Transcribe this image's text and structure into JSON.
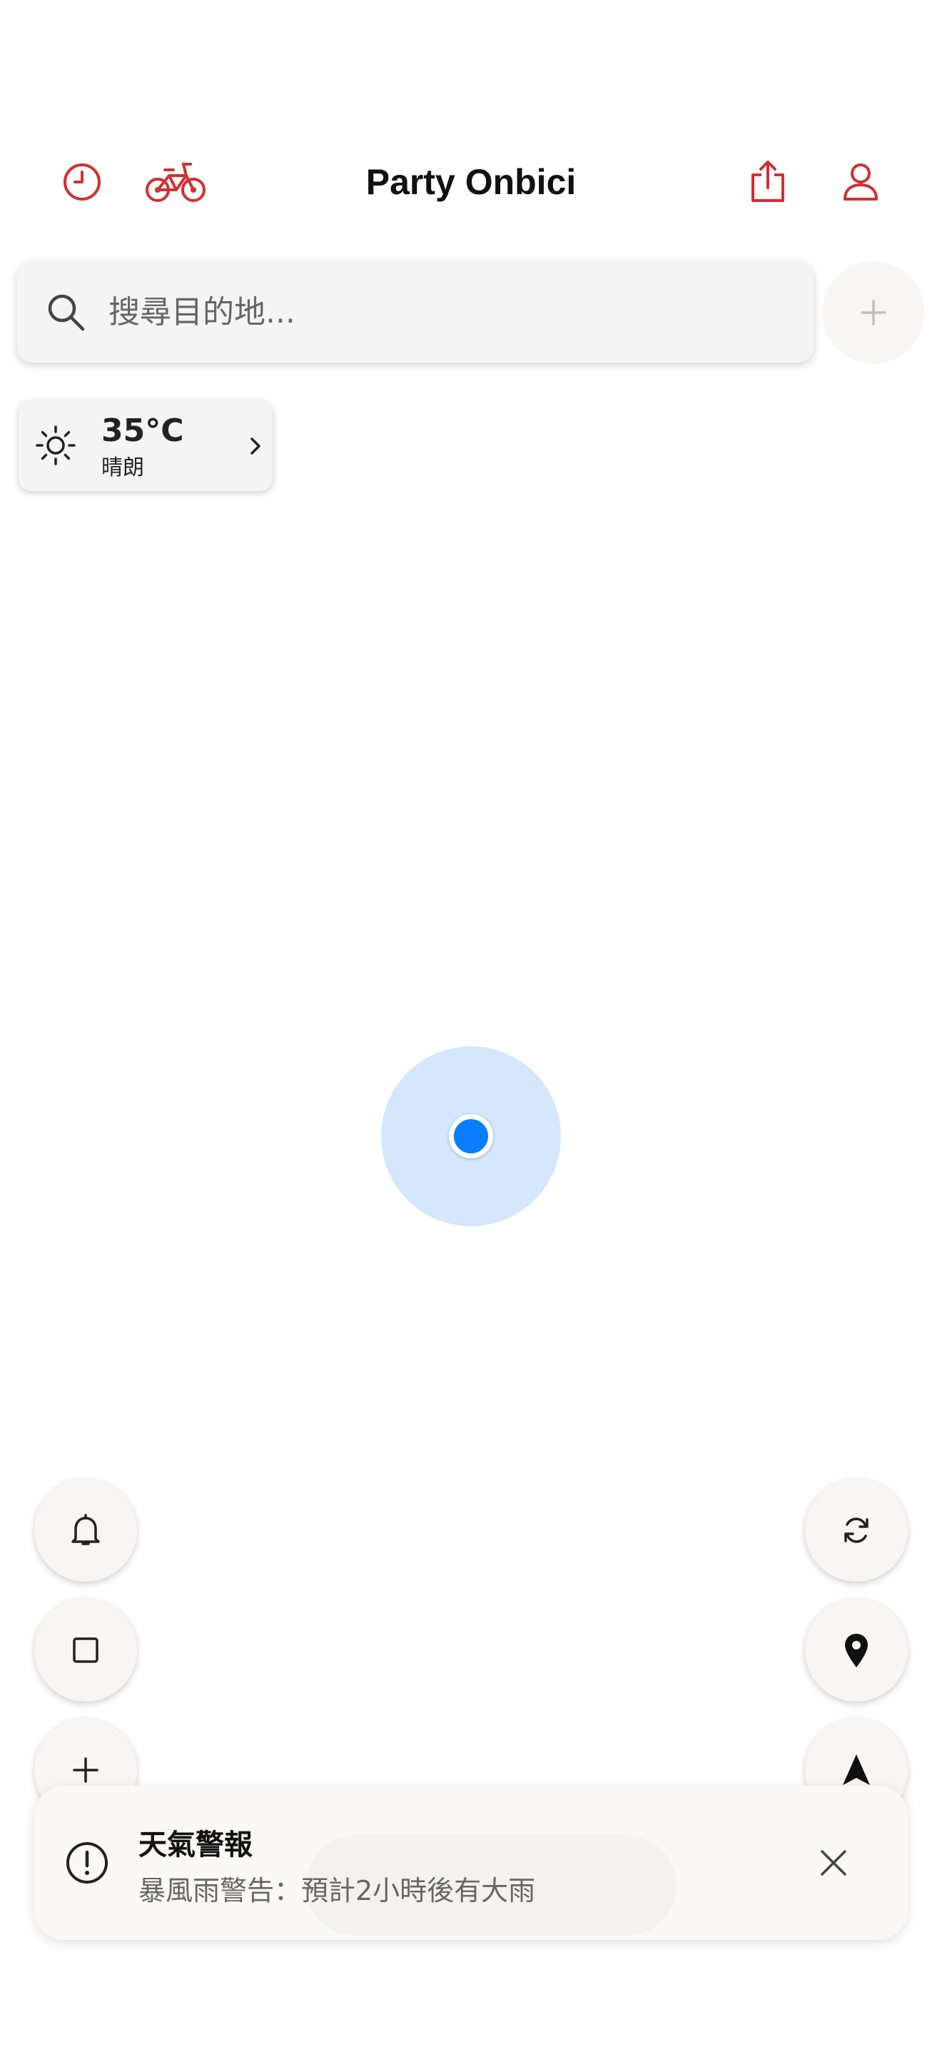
{
  "header": {
    "title": "Party Onbici",
    "accent_color": "#d32f2f",
    "icons": [
      "clock-icon",
      "bicycle-icon",
      "share-icon",
      "profile-icon"
    ]
  },
  "search": {
    "placeholder": "搜尋目的地...",
    "value": ""
  },
  "weather": {
    "temperature": "35°C",
    "condition": "晴朗",
    "icon": "sun-icon"
  },
  "map": {
    "location_color": "#0a7cff",
    "accuracy_color": "#d4e7fc"
  },
  "controls": {
    "left": [
      "bell-icon",
      "square-icon",
      "plus-icon"
    ],
    "right": [
      "refresh-icon",
      "pin-icon",
      "navigation-arrow-icon"
    ]
  },
  "alert": {
    "title": "天氣警報",
    "message": "暴風雨警告：預計2小時後有大雨",
    "icon": "exclamation-circle-icon"
  }
}
